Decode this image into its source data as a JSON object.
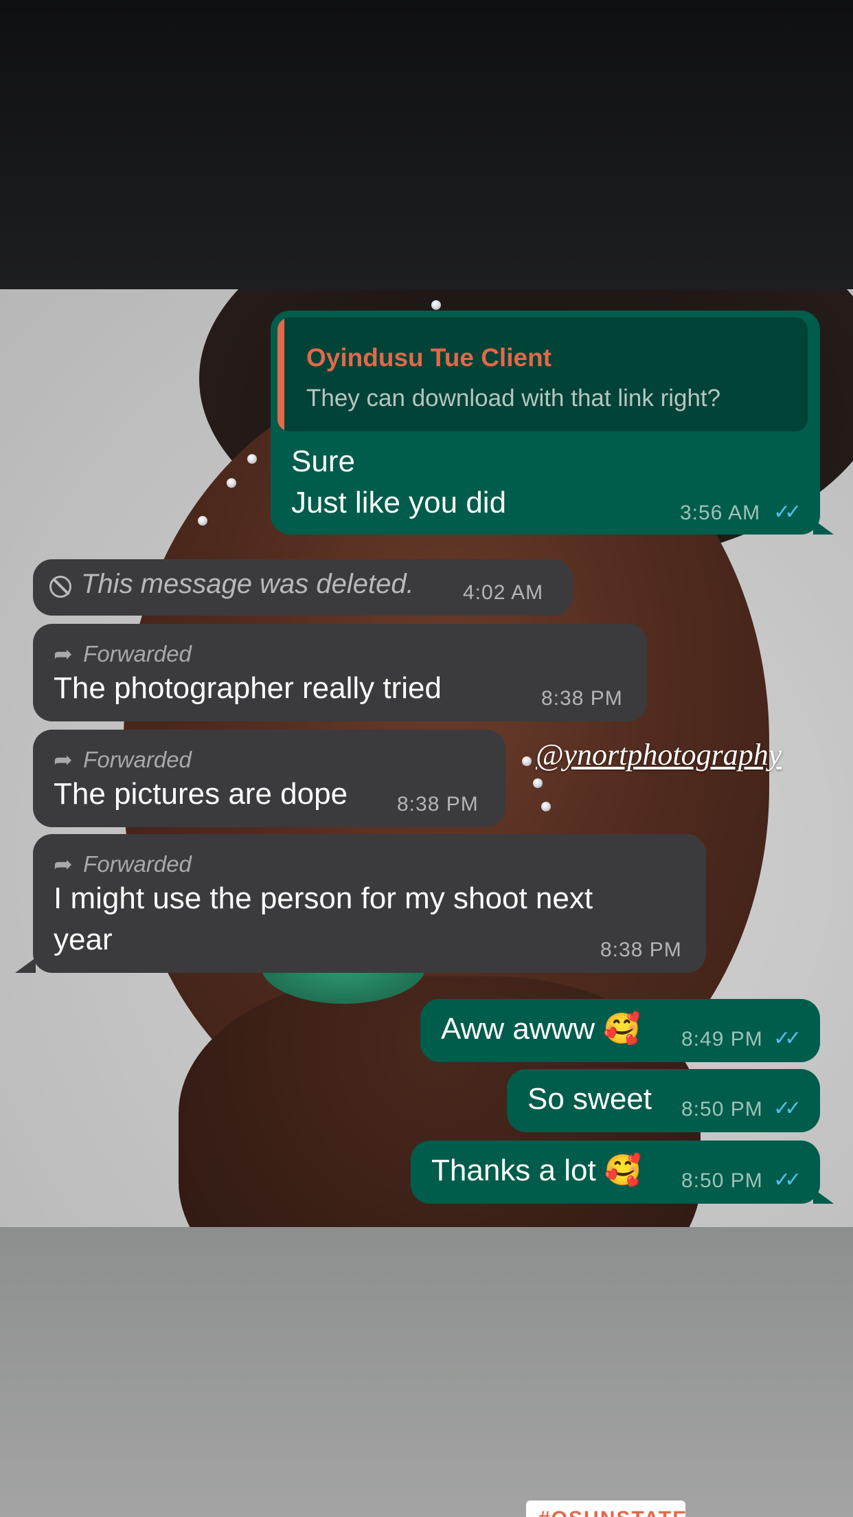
{
  "watermark": "@ynortphotography",
  "messages": [
    {
      "type": "outgoing",
      "quote": {
        "name": "Oyindusu Tue Client",
        "text": "They can download with that link right?"
      },
      "lines": [
        "Sure",
        "Just like you did"
      ],
      "time": "3:56 AM",
      "ticks": "✓✓"
    },
    {
      "type": "incoming",
      "deleted": true,
      "text": "This message was deleted.",
      "time": "4:02 AM"
    },
    {
      "type": "incoming",
      "forwarded": "Forwarded",
      "text": "The photographer really tried",
      "time": "8:38 PM"
    },
    {
      "type": "incoming",
      "forwarded": "Forwarded",
      "text": "The pictures are dope",
      "time": "8:38 PM"
    },
    {
      "type": "incoming",
      "forwarded": "Forwarded",
      "lines": [
        "I might use the person for my shoot next",
        "year"
      ],
      "time": "8:38 PM"
    },
    {
      "type": "outgoing",
      "text": "Aww awww 🥰",
      "time": "8:49 PM",
      "ticks": "✓✓"
    },
    {
      "type": "outgoing",
      "text": "So sweet",
      "time": "8:50 PM",
      "ticks": "✓✓"
    },
    {
      "type": "outgoing",
      "text": "Thanks a lot 🥰",
      "time": "8:50 PM",
      "ticks": "✓✓"
    }
  ],
  "sticker": {
    "text": "#OSUNSTATE"
  },
  "colors": {
    "outgoing_bubble": "#005c4b",
    "incoming_bubble": "#3b3b3d",
    "quote_accent": "#e2694a",
    "read_ticks": "#53bdeb"
  },
  "icons": {
    "forward": "forward-arrow-icon",
    "deleted": "block-icon",
    "read": "double-check-icon"
  }
}
